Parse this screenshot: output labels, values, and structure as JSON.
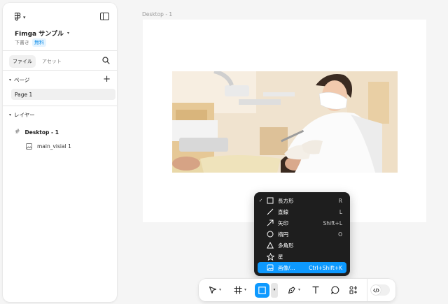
{
  "sidebar": {
    "file_name": "Fimga サンプル",
    "draft_label": "下書き",
    "plan_badge": "無料",
    "tabs": [
      {
        "label": "ファイル",
        "active": true
      },
      {
        "label": "アセット",
        "active": false
      }
    ],
    "pages_header": "ページ",
    "pages": [
      {
        "label": "Page 1",
        "selected": true
      }
    ],
    "layers_header": "レイヤー",
    "layers": [
      {
        "label": "Desktop - 1",
        "icon": "frame-icon"
      },
      {
        "label": "main_visial 1",
        "icon": "image-icon"
      }
    ]
  },
  "canvas": {
    "frame_label": "Desktop - 1",
    "image_name": "main_visial 1"
  },
  "shape_menu": {
    "items": [
      {
        "label": "長方形",
        "shortcut": "R",
        "icon": "rectangle-icon",
        "checked": true,
        "highlighted": false
      },
      {
        "label": "直線",
        "shortcut": "L",
        "icon": "line-icon",
        "checked": false,
        "highlighted": false
      },
      {
        "label": "矢印",
        "shortcut": "Shift+L",
        "icon": "arrow-icon",
        "checked": false,
        "highlighted": false
      },
      {
        "label": "楕円",
        "shortcut": "O",
        "icon": "ellipse-icon",
        "checked": false,
        "highlighted": false
      },
      {
        "label": "多角形",
        "shortcut": "",
        "icon": "polygon-icon",
        "checked": false,
        "highlighted": false
      },
      {
        "label": "星",
        "shortcut": "",
        "icon": "star-icon",
        "checked": false,
        "highlighted": false
      },
      {
        "label": "画像/...",
        "shortcut": "Ctrl+Shift+K",
        "icon": "image-icon",
        "checked": false,
        "highlighted": true
      }
    ]
  },
  "toolbar": {
    "tools": [
      "move-tool",
      "frame-tool",
      "shape-tool",
      "pen-tool",
      "text-tool",
      "comment-tool",
      "actions-tool"
    ],
    "active_tool": "shape-tool",
    "dev_mode": false
  },
  "colors": {
    "accent": "#0d99ff",
    "menu_bg": "#1e1e1e",
    "canvas_bg": "#f5f5f5"
  }
}
